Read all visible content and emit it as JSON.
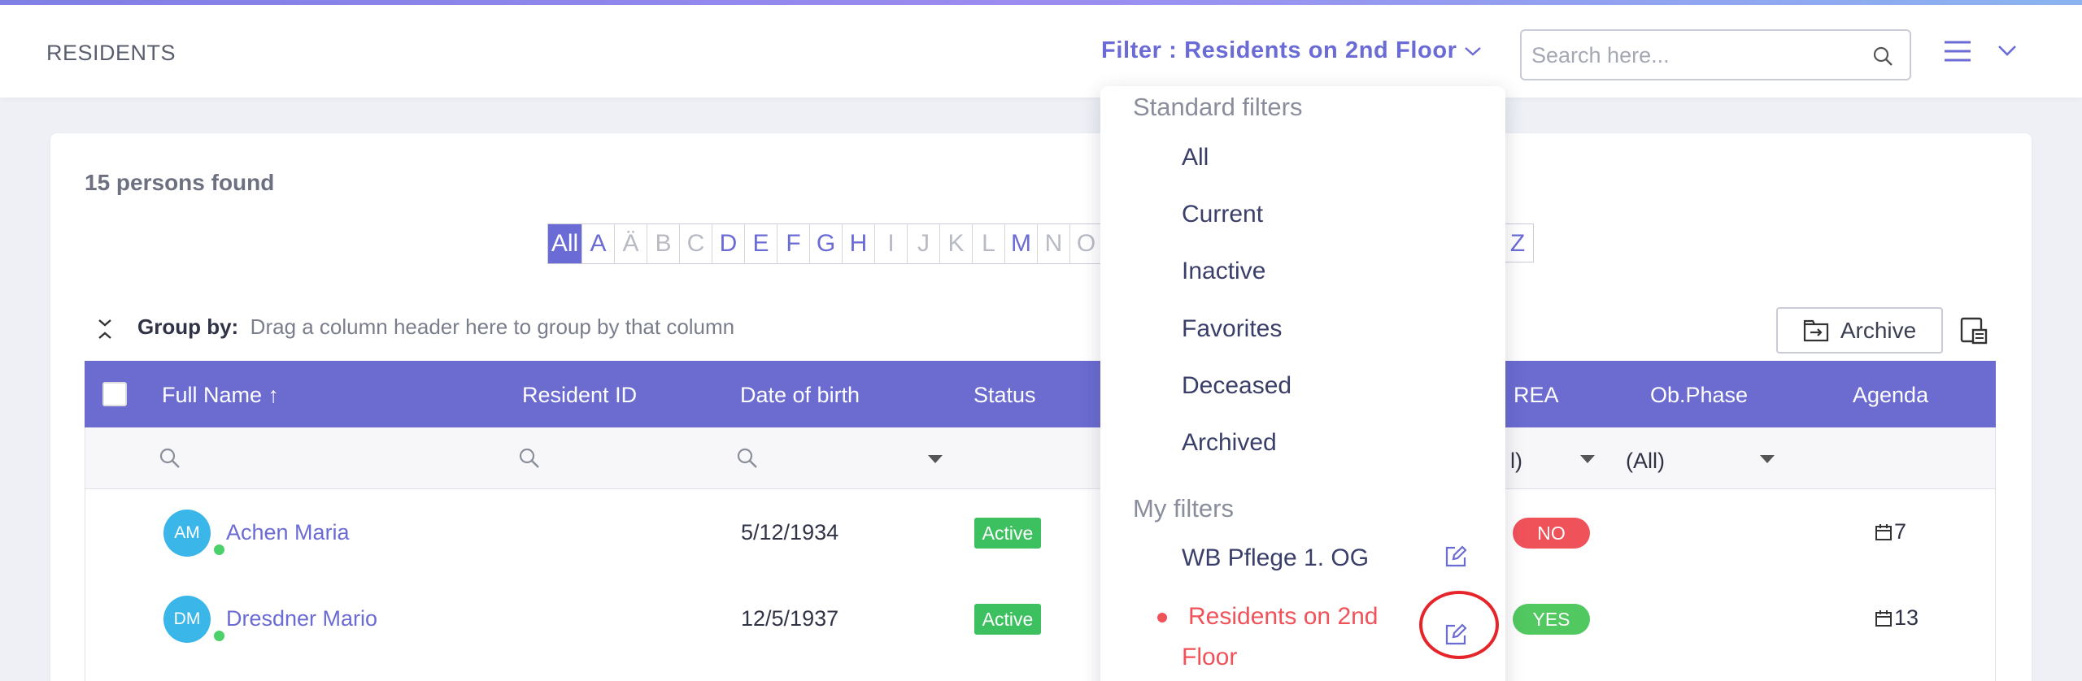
{
  "header": {
    "title": "RESIDENTS",
    "filter_label": "Filter : Residents on 2nd Floor",
    "search_placeholder": "Search here..."
  },
  "summary": {
    "found_text": "15 persons found"
  },
  "alphabet": {
    "letters": [
      "All",
      "A",
      "Ä",
      "B",
      "C",
      "D",
      "E",
      "F",
      "G",
      "H",
      "I",
      "J",
      "K",
      "L",
      "M",
      "N",
      "O"
    ],
    "enabled": [
      "A",
      "D",
      "E",
      "F",
      "G",
      "H",
      "M"
    ],
    "selected": "All",
    "last_letter": "Z"
  },
  "groupby": {
    "label": "Group by:",
    "hint": "Drag a column header here to group by that column"
  },
  "toolbar": {
    "archive_label": "Archive"
  },
  "table": {
    "headers": {
      "full_name": "Full Name ↑",
      "resident_id": "Resident ID",
      "date_of_birth": "Date of birth",
      "status": "Status",
      "rea": "REA",
      "ob_phase": "Ob.Phase",
      "agenda": "Agenda"
    },
    "filter_values": {
      "rea": "l)",
      "ob_phase": "(All)"
    },
    "rows": [
      {
        "initials": "AM",
        "name": "Achen Maria",
        "dob": "5/12/1934",
        "status": "Active",
        "rea": "NO",
        "agenda": "7"
      },
      {
        "initials": "DM",
        "name": "Dresdner Mario",
        "dob": "12/5/1937",
        "status": "Active",
        "rea": "YES",
        "agenda": "13"
      }
    ]
  },
  "dropdown": {
    "standard_heading": "Standard filters",
    "standard_items": [
      "All",
      "Current",
      "Inactive",
      "Favorites",
      "Deceased",
      "Archived"
    ],
    "my_heading": "My filters",
    "my_items": [
      {
        "label": "WB Pflege 1. OG",
        "active": false
      },
      {
        "label_line1": "Residents on 2nd",
        "label_line2": "Floor",
        "active": true
      }
    ]
  },
  "colors": {
    "accent": "#6b6bd6",
    "header_bg": "#6b6bd0",
    "status_active": "#3cc060",
    "rea_no": "#f0525a",
    "rea_yes": "#52c860",
    "highlight_circle": "#e5252a"
  }
}
